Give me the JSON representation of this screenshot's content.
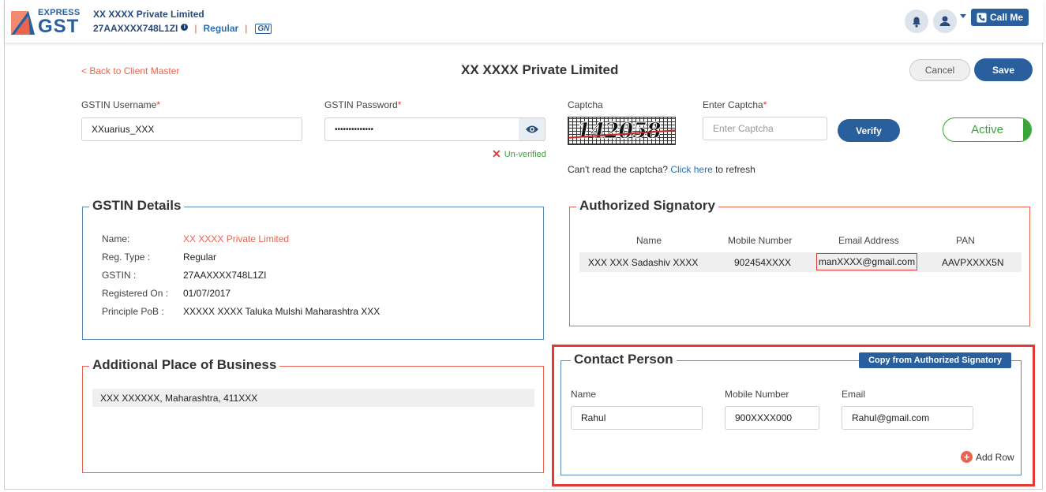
{
  "header": {
    "logo_express": "EXPRESS",
    "logo_gst": "GST",
    "company_name": "XX XXXX Private Limited",
    "gstin": "27AAXXXX748L1ZI",
    "info_icon": "i",
    "reg_type": "Regular",
    "sep": "|",
    "gsn_badge": "GN",
    "call_me": "Call Me",
    "icons": [
      "bell-icon",
      "user-icon",
      "caret-down-icon",
      "phone-icon"
    ]
  },
  "page": {
    "back_link": "< Back to Client Master",
    "title": "XX XXXX Private Limited",
    "cancel": "Cancel",
    "save": "Save"
  },
  "credentials": {
    "username_label": "GSTIN Username",
    "username_value": "XXuarius_XXX",
    "password_label": "GSTIN Password",
    "password_value": "••••••••••••••",
    "required_mark": "*",
    "unverified_mark": "✕",
    "unverified": "Un-verified",
    "captcha_label": "Captcha",
    "captcha_text": "142058",
    "enter_captcha_label": "Enter Captcha",
    "enter_captcha_placeholder": "Enter Captcha",
    "verify": "Verify",
    "status": "Active",
    "refresh_prefix": "Can't read the captcha?",
    "refresh_link": "Click here",
    "refresh_suffix": "to refresh"
  },
  "gstin_details": {
    "title": "GSTIN Details",
    "rows": [
      {
        "key": "Name:",
        "value": "XX XXXX Private Limited"
      },
      {
        "key": "Reg. Type :",
        "value": "Regular"
      },
      {
        "key": "GSTIN :",
        "value": "27AAXXXX748L1ZI"
      },
      {
        "key": "Registered On :",
        "value": "01/07/2017"
      },
      {
        "key": "Principle PoB :",
        "value": "XXXXX XXXX Taluka Mulshi Maharashtra XXX"
      }
    ]
  },
  "authorized_signatory": {
    "title": "Authorized Signatory",
    "columns": [
      "Name",
      "Mobile Number",
      "Email Address",
      "PAN"
    ],
    "row": {
      "name": "XXX XXX Sadashiv XXXX",
      "mobile": "902454XXXX",
      "email": "manXXXX@gmail.com",
      "pan": "AAVPXXXX5N"
    }
  },
  "additional_pob": {
    "title": "Additional Place of Business",
    "row": "XXX XXXXXX, Maharashtra, 411XXX"
  },
  "contact_person": {
    "title": "Contact Person",
    "copy_button": "Copy from Authorized Signatory",
    "name_label": "Name",
    "mobile_label": "Mobile Number",
    "email_label": "Email",
    "name_value": "Rahul",
    "mobile_value": "900XXXX000",
    "email_value": "Rahul@gmail.com",
    "add_row_icon": "+",
    "add_row": "Add Row"
  },
  "colors": {
    "brand": "#2a5f9e",
    "accent": "#e9634e",
    "success": "#3aa33a",
    "highlight": "#e53935"
  }
}
